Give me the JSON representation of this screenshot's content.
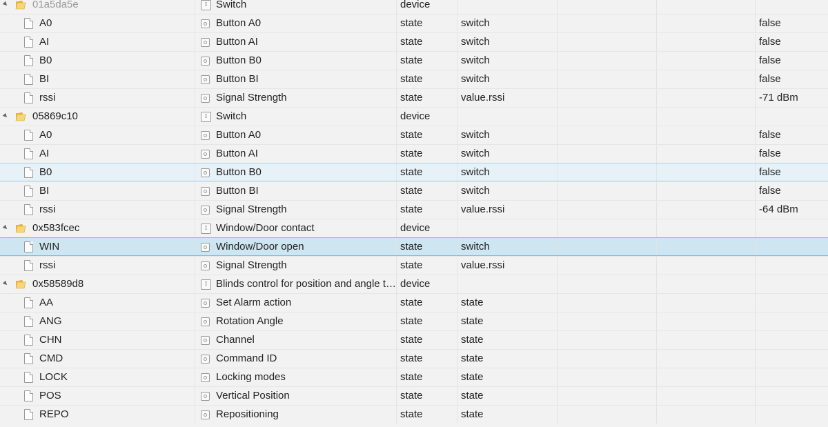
{
  "rows": [
    {
      "kind": "device",
      "name": "01a5da5e",
      "label": "Switch",
      "type": "device",
      "role": "",
      "value": "",
      "dim": true
    },
    {
      "kind": "state",
      "name": "A0",
      "label": "Button A0",
      "type": "state",
      "role": "switch",
      "value": "false"
    },
    {
      "kind": "state",
      "name": "AI",
      "label": "Button AI",
      "type": "state",
      "role": "switch",
      "value": "false"
    },
    {
      "kind": "state",
      "name": "B0",
      "label": "Button B0",
      "type": "state",
      "role": "switch",
      "value": "false"
    },
    {
      "kind": "state",
      "name": "BI",
      "label": "Button BI",
      "type": "state",
      "role": "switch",
      "value": "false"
    },
    {
      "kind": "state",
      "name": "rssi",
      "label": "Signal Strength",
      "type": "state",
      "role": "value.rssi",
      "value": "-71 dBm"
    },
    {
      "kind": "device",
      "name": "05869c10",
      "label": "Switch",
      "type": "device",
      "role": "",
      "value": ""
    },
    {
      "kind": "state",
      "name": "A0",
      "label": "Button A0",
      "type": "state",
      "role": "switch",
      "value": "false"
    },
    {
      "kind": "state",
      "name": "AI",
      "label": "Button AI",
      "type": "state",
      "role": "switch",
      "value": "false"
    },
    {
      "kind": "state",
      "name": "B0",
      "label": "Button B0",
      "type": "state",
      "role": "switch",
      "value": "false",
      "highlight": "light"
    },
    {
      "kind": "state",
      "name": "BI",
      "label": "Button BI",
      "type": "state",
      "role": "switch",
      "value": "false"
    },
    {
      "kind": "state",
      "name": "rssi",
      "label": "Signal Strength",
      "type": "state",
      "role": "value.rssi",
      "value": "-64 dBm"
    },
    {
      "kind": "device",
      "name": "0x583fcec",
      "label": "Window/Door contact",
      "type": "device",
      "role": "",
      "value": ""
    },
    {
      "kind": "state",
      "name": "WIN",
      "label": "Window/Door open",
      "type": "state",
      "role": "switch",
      "value": "",
      "highlight": "strong"
    },
    {
      "kind": "state",
      "name": "rssi",
      "label": "Signal Strength",
      "type": "state",
      "role": "value.rssi",
      "value": ""
    },
    {
      "kind": "device",
      "name": "0x58589d8",
      "label": "Blinds control for position and angle ty...",
      "type": "device",
      "role": "",
      "value": ""
    },
    {
      "kind": "state",
      "name": "AA",
      "label": "Set Alarm action",
      "type": "state",
      "role": "state",
      "value": ""
    },
    {
      "kind": "state",
      "name": "ANG",
      "label": "Rotation Angle",
      "type": "state",
      "role": "state",
      "value": ""
    },
    {
      "kind": "state",
      "name": "CHN",
      "label": "Channel",
      "type": "state",
      "role": "state",
      "value": ""
    },
    {
      "kind": "state",
      "name": "CMD",
      "label": "Command ID",
      "type": "state",
      "role": "state",
      "value": ""
    },
    {
      "kind": "state",
      "name": "LOCK",
      "label": "Locking modes",
      "type": "state",
      "role": "state",
      "value": ""
    },
    {
      "kind": "state",
      "name": "POS",
      "label": "Vertical Position",
      "type": "state",
      "role": "state",
      "value": ""
    },
    {
      "kind": "state",
      "name": "REPO",
      "label": "Repositioning",
      "type": "state",
      "role": "state",
      "value": ""
    }
  ]
}
